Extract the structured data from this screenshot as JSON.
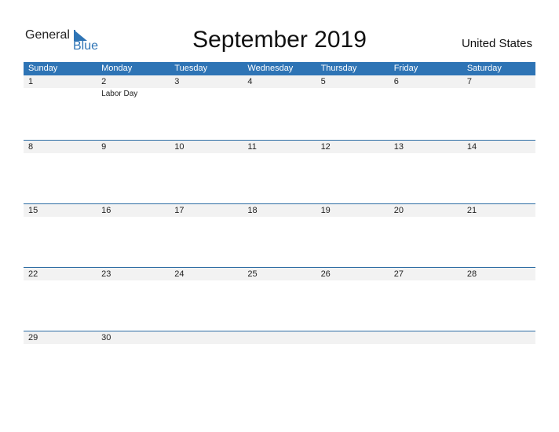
{
  "logo": {
    "general": "General",
    "blue": "Blue"
  },
  "title": "September 2019",
  "country": "United States",
  "days": [
    "Sunday",
    "Monday",
    "Tuesday",
    "Wednesday",
    "Thursday",
    "Friday",
    "Saturday"
  ],
  "weeks": [
    {
      "dates": [
        "1",
        "2",
        "3",
        "4",
        "5",
        "6",
        "7"
      ],
      "events": [
        "",
        "Labor Day",
        "",
        "",
        "",
        "",
        ""
      ]
    },
    {
      "dates": [
        "8",
        "9",
        "10",
        "11",
        "12",
        "13",
        "14"
      ],
      "events": [
        "",
        "",
        "",
        "",
        "",
        "",
        ""
      ]
    },
    {
      "dates": [
        "15",
        "16",
        "17",
        "18",
        "19",
        "20",
        "21"
      ],
      "events": [
        "",
        "",
        "",
        "",
        "",
        "",
        ""
      ]
    },
    {
      "dates": [
        "22",
        "23",
        "24",
        "25",
        "26",
        "27",
        "28"
      ],
      "events": [
        "",
        "",
        "",
        "",
        "",
        "",
        ""
      ]
    },
    {
      "dates": [
        "29",
        "30",
        "",
        "",
        "",
        "",
        ""
      ],
      "events": [
        "",
        "",
        "",
        "",
        "",
        "",
        ""
      ]
    }
  ]
}
